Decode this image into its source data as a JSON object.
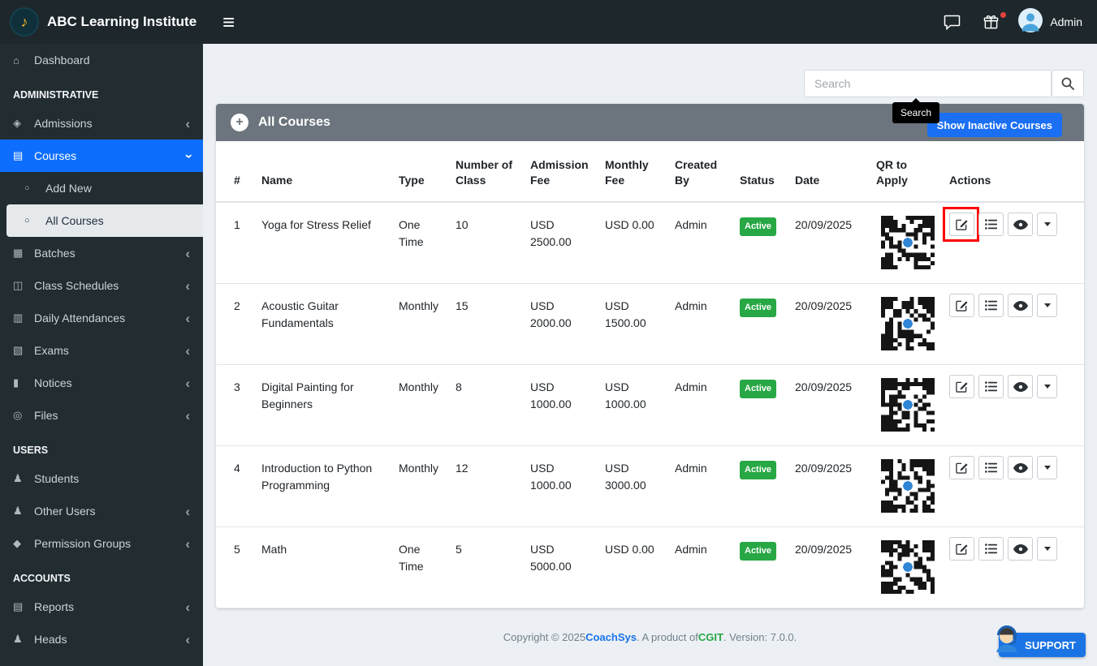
{
  "navbar": {
    "brand": "ABC Learning Institute",
    "user": "Admin"
  },
  "icons": {
    "hamburger": "≡",
    "logo": "♪",
    "chevron": "‹",
    "plus": "+"
  },
  "sidebar": {
    "items": [
      {
        "label": "Dashboard",
        "icon": "⌂"
      },
      {
        "label": "ADMINISTRATIVE"
      },
      {
        "label": "Admissions",
        "icon": "◈"
      },
      {
        "label": "Courses",
        "icon": "▤"
      },
      {
        "label": "Add New",
        "icon": "○"
      },
      {
        "label": "All Courses",
        "icon": "○"
      },
      {
        "label": "Batches",
        "icon": "▦"
      },
      {
        "label": "Class Schedules",
        "icon": "◫"
      },
      {
        "label": "Daily Attendances",
        "icon": "▥"
      },
      {
        "label": "Exams",
        "icon": "▧"
      },
      {
        "label": "Notices",
        "icon": "▮"
      },
      {
        "label": "Files",
        "icon": "◎"
      },
      {
        "label": "USERS"
      },
      {
        "label": "Students",
        "icon": "♟"
      },
      {
        "label": "Other Users",
        "icon": "♟"
      },
      {
        "label": "Permission Groups",
        "icon": "◆"
      },
      {
        "label": "ACCOUNTS"
      },
      {
        "label": "Reports",
        "icon": "▤"
      },
      {
        "label": "Heads",
        "icon": "♟"
      }
    ]
  },
  "search": {
    "placeholder": "Search",
    "tooltip": "Search"
  },
  "toolbar": {
    "show_inactive_label": "Show Inactive Courses"
  },
  "card": {
    "title": "All Courses"
  },
  "table": {
    "columns": [
      "#",
      "Name",
      "Type",
      "Number of Class",
      "Admission Fee",
      "Monthly Fee",
      "Created By",
      "Status",
      "Date",
      "QR to Apply",
      "Actions"
    ],
    "rows": [
      {
        "num": "1",
        "name": "Yoga for Stress Relief",
        "type": "One Time",
        "classes": "10",
        "admission_fee": "USD 2500.00",
        "monthly_fee": "USD 0.00",
        "created_by": "Admin",
        "status": "Active",
        "date": "20/09/2025"
      },
      {
        "num": "2",
        "name": "Acoustic Guitar Fundamentals",
        "type": "Monthly",
        "classes": "15",
        "admission_fee": "USD 2000.00",
        "monthly_fee": "USD 1500.00",
        "created_by": "Admin",
        "status": "Active",
        "date": "20/09/2025"
      },
      {
        "num": "3",
        "name": "Digital Painting for Beginners",
        "type": "Monthly",
        "classes": "8",
        "admission_fee": "USD 1000.00",
        "monthly_fee": "USD 1000.00",
        "created_by": "Admin",
        "status": "Active",
        "date": "20/09/2025"
      },
      {
        "num": "4",
        "name": "Introduction to Python Programming",
        "type": "Monthly",
        "classes": "12",
        "admission_fee": "USD 1000.00",
        "monthly_fee": "USD 3000.00",
        "created_by": "Admin",
        "status": "Active",
        "date": "20/09/2025"
      },
      {
        "num": "5",
        "name": "Math",
        "type": "One Time",
        "classes": "5",
        "admission_fee": "USD 5000.00",
        "monthly_fee": "USD 0.00",
        "created_by": "Admin",
        "status": "Active",
        "date": "20/09/2025"
      }
    ]
  },
  "footer": {
    "copyright_prefix": "Copyright © 2025 ",
    "brand": "CoachSys",
    "product_text": ". A product of ",
    "company": "CGIT",
    "version_text": ". Version: 7.0.0.",
    "support_label": "SUPPORT"
  },
  "colors": {
    "accent_blue": "#1a6ff3",
    "badge_green": "#28a745",
    "card_header_gray": "#6c757d",
    "navbar_dark": "#1d272c",
    "sidebar_dark": "#222d32",
    "annotation_red": "#ff0000",
    "link_blue": "#1a73e8",
    "link_green": "#28a745"
  }
}
